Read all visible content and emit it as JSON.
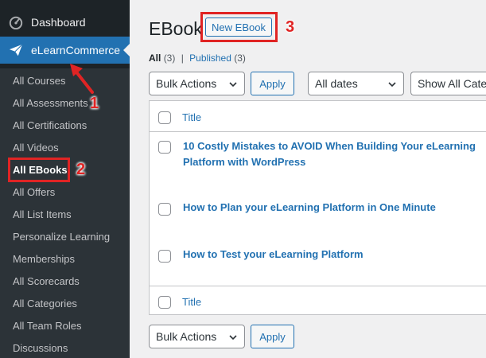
{
  "sidebar": {
    "dashboard": "Dashboard",
    "active_menu": "eLearnCommerce",
    "items": [
      {
        "label": "All Courses"
      },
      {
        "label": "All Assessments"
      },
      {
        "label": "All Certifications"
      },
      {
        "label": "All Videos"
      },
      {
        "label": "All EBooks"
      },
      {
        "label": "All Offers"
      },
      {
        "label": "All List Items"
      },
      {
        "label": "Personalize Learning"
      },
      {
        "label": "Memberships"
      },
      {
        "label": "All Scorecards"
      },
      {
        "label": "All Categories"
      },
      {
        "label": "All Team Roles"
      },
      {
        "label": "Discussions"
      }
    ]
  },
  "header": {
    "title": "EBook",
    "add_new_label": "New EBook"
  },
  "filters": {
    "all_label": "All",
    "all_count": "(3)",
    "separator": "|",
    "published_label": "Published",
    "published_count": "(3)"
  },
  "toolbar": {
    "bulk_actions": "Bulk Actions",
    "apply": "Apply",
    "dates": "All dates",
    "categories": "Show All Categories"
  },
  "table": {
    "column_title": "Title",
    "rows": [
      {
        "title": "10 Costly Mistakes to AVOID When Building Your eLearning Platform with WordPress"
      },
      {
        "title": "How to Plan your eLearning Platform in One Minute"
      },
      {
        "title": "How to Test your eLearning Platform"
      }
    ],
    "footer_title": "Title"
  },
  "bottom_toolbar": {
    "bulk_actions": "Bulk Actions",
    "apply": "Apply"
  },
  "annotations": {
    "step1": "1",
    "step2": "2",
    "step3": "3"
  },
  "colors": {
    "sidebar_bg": "#1d2327",
    "submenu_bg": "#2c3338",
    "accent": "#2271b1",
    "annotation_red": "#e02424"
  }
}
